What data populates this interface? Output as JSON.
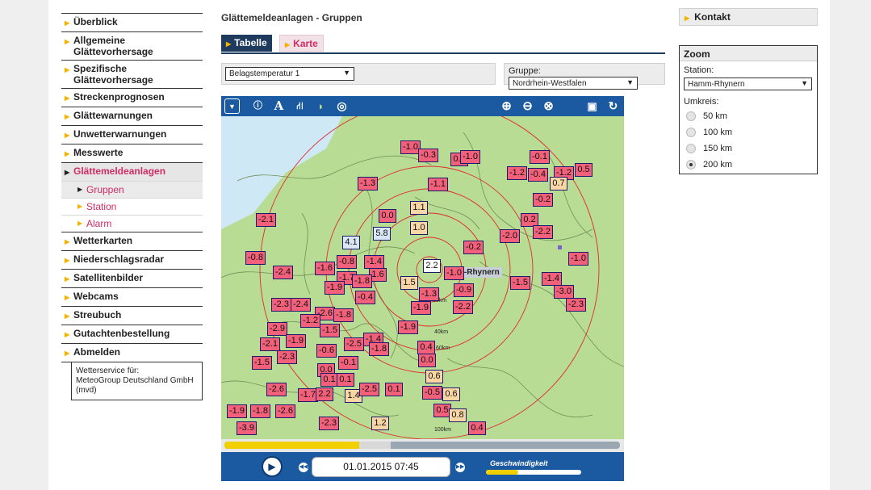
{
  "nav": {
    "items": [
      {
        "label": "Überblick"
      },
      {
        "label": "Allgemeine Glättevorhersage"
      },
      {
        "label": "Spezifische Glättevorhersage"
      },
      {
        "label": "Streckenprognosen"
      },
      {
        "label": "Glättewarnungen"
      },
      {
        "label": "Unwetterwarnungen"
      },
      {
        "label": "Messwerte"
      },
      {
        "label": "Glättemeldeanlagen"
      },
      {
        "label": "Gruppen"
      },
      {
        "label": "Station"
      },
      {
        "label": "Alarm"
      },
      {
        "label": "Wetterkarten"
      },
      {
        "label": "Niederschlagsradar"
      },
      {
        "label": "Satellitenbilder"
      },
      {
        "label": "Webcams"
      },
      {
        "label": "Streubuch"
      },
      {
        "label": "Gutachtenbestellung"
      },
      {
        "label": "Abmelden"
      }
    ],
    "credit": "Wetterservice für:\nMeteoGroup Deutschland GmbH (mvd)"
  },
  "main": {
    "title": "Glättemeldeanlagen - Gruppen",
    "tabs": [
      {
        "label": "Tabelle"
      },
      {
        "label": "Karte"
      }
    ],
    "parameter_select": "Belagstemperatur 1",
    "group_label": "Gruppe:",
    "group_select": "Nordrhein-Westfalen"
  },
  "map": {
    "station_label": "m-Rhynern",
    "km_labels": [
      "20km",
      "40km",
      "60km",
      "100km"
    ],
    "tags": [
      {
        "v": "-1.0",
        "c": "neg"
      },
      {
        "v": "-0.3",
        "c": "neg"
      },
      {
        "v": "0.2",
        "c": "neg"
      },
      {
        "v": "-1.0",
        "c": "neg"
      },
      {
        "v": "-0.1",
        "c": "neg"
      },
      {
        "v": "-1.2",
        "c": "neg"
      },
      {
        "v": "-0.4",
        "c": "neg"
      },
      {
        "v": "-1.2",
        "c": "neg"
      },
      {
        "v": "0.5",
        "c": "neg"
      },
      {
        "v": "0.7",
        "c": "warm"
      },
      {
        "v": "-1.3",
        "c": "neg"
      },
      {
        "v": "-1.1",
        "c": "neg"
      },
      {
        "v": "-0.2",
        "c": "neg"
      },
      {
        "v": "1.1",
        "c": "warm"
      },
      {
        "v": "-2.1",
        "c": "neg"
      },
      {
        "v": "0.0",
        "c": "neg"
      },
      {
        "v": "0.2",
        "c": "neg"
      },
      {
        "v": "-2.2",
        "c": "neg"
      },
      {
        "v": "1.0",
        "c": "warm"
      },
      {
        "v": "5.8",
        "c": "cool"
      },
      {
        "v": "-2.0",
        "c": "neg"
      },
      {
        "v": "4.1",
        "c": "cool"
      },
      {
        "v": "-0.2",
        "c": "neg"
      },
      {
        "v": "-1.0",
        "c": "neg"
      },
      {
        "v": "-0.8",
        "c": "neg"
      },
      {
        "v": "-1.4",
        "c": "neg"
      },
      {
        "v": "-0.8",
        "c": "neg"
      },
      {
        "v": "-1.6",
        "c": "neg"
      },
      {
        "v": "2.2",
        "c": "white"
      },
      {
        "v": "-2.4",
        "c": "neg"
      },
      {
        "v": "-1.7",
        "c": "neg"
      },
      {
        "v": "1.6",
        "c": "neg"
      },
      {
        "v": "-1.0",
        "c": "neg"
      },
      {
        "v": "-1.8",
        "c": "neg"
      },
      {
        "v": "-1.9",
        "c": "neg"
      },
      {
        "v": "1.5",
        "c": "warm"
      },
      {
        "v": "-1.5",
        "c": "neg"
      },
      {
        "v": "-1.4",
        "c": "neg"
      },
      {
        "v": "-0.9",
        "c": "neg"
      },
      {
        "v": "-3.0",
        "c": "neg"
      },
      {
        "v": "-0.4",
        "c": "neg"
      },
      {
        "v": "-1.3",
        "c": "neg"
      },
      {
        "v": "-2.3",
        "c": "neg"
      },
      {
        "v": "-2.4",
        "c": "neg"
      },
      {
        "v": "-2.2",
        "c": "neg"
      },
      {
        "v": "-2.3",
        "c": "neg"
      },
      {
        "v": "-2.6",
        "c": "neg"
      },
      {
        "v": "-1.8",
        "c": "neg"
      },
      {
        "v": "-1.9",
        "c": "neg"
      },
      {
        "v": "-2.9",
        "c": "neg"
      },
      {
        "v": "-1.5",
        "c": "neg"
      },
      {
        "v": "-1.2",
        "c": "neg"
      },
      {
        "v": "-1.9",
        "c": "neg"
      },
      {
        "v": "-1.4",
        "c": "neg"
      },
      {
        "v": "-2.1",
        "c": "neg"
      },
      {
        "v": "-1.9",
        "c": "neg"
      },
      {
        "v": "-2.5",
        "c": "neg"
      },
      {
        "v": "-1.8",
        "c": "neg"
      },
      {
        "v": "0.4",
        "c": "neg"
      },
      {
        "v": "-0.6",
        "c": "neg"
      },
      {
        "v": "-2.3",
        "c": "neg"
      },
      {
        "v": "0.0",
        "c": "neg"
      },
      {
        "v": "-0.1",
        "c": "neg"
      },
      {
        "v": "0.0",
        "c": "neg"
      },
      {
        "v": "0.6",
        "c": "warm"
      },
      {
        "v": "0.1",
        "c": "neg"
      },
      {
        "v": "0.1",
        "c": "neg"
      },
      {
        "v": "-2.6",
        "c": "neg"
      },
      {
        "v": "-1.7",
        "c": "neg"
      },
      {
        "v": "2.2",
        "c": "neg"
      },
      {
        "v": "1.4",
        "c": "warm"
      },
      {
        "v": "-2.5",
        "c": "neg"
      },
      {
        "v": "0.1",
        "c": "neg"
      },
      {
        "v": "-0.5",
        "c": "neg"
      },
      {
        "v": "0.6",
        "c": "warm"
      },
      {
        "v": "-1.9",
        "c": "neg"
      },
      {
        "v": "-1.8",
        "c": "neg"
      },
      {
        "v": "-2.6",
        "c": "neg"
      },
      {
        "v": "0.5",
        "c": "neg"
      },
      {
        "v": "0.8",
        "c": "warm"
      },
      {
        "v": "-2.3",
        "c": "neg"
      },
      {
        "v": "1.2",
        "c": "warm"
      },
      {
        "v": "-3.9",
        "c": "neg"
      },
      {
        "v": "0.4",
        "c": "neg"
      },
      {
        "v": "-1.5",
        "c": "neg"
      }
    ],
    "player": {
      "datetime": "01.01.2015 07:45",
      "speed_label": "Geschwindigkeit",
      "progress_fraction": 0.34
    }
  },
  "right": {
    "contact": "Kontakt",
    "zoom_title": "Zoom",
    "station_label": "Station:",
    "station_select": "Hamm-Rhynern",
    "radius_label": "Umkreis:",
    "radius_options": [
      {
        "label": "50 km",
        "checked": false
      },
      {
        "label": "100 km",
        "checked": false
      },
      {
        "label": "150 km",
        "checked": false
      },
      {
        "label": "200 km",
        "checked": true
      }
    ]
  },
  "colors": {
    "neg_tag": "#f2607a",
    "warm_tag": "#f9d6a4",
    "cool_tag": "#d9e6f4",
    "land": "#b9dc95",
    "accent_pink": "#d12b63",
    "nav_arrow": "#f3b300",
    "toolbar_blue": "#1b5aa0"
  }
}
